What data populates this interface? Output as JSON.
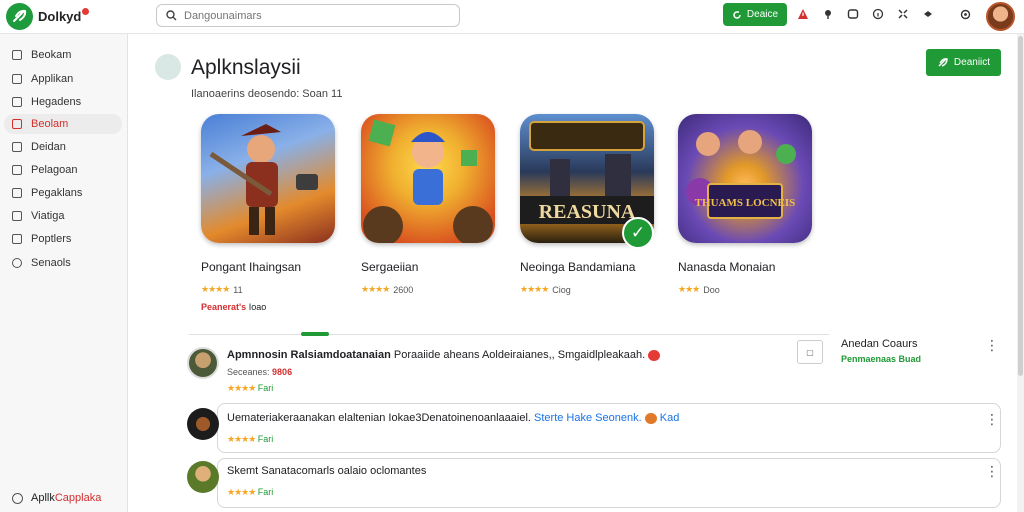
{
  "app": {
    "name": "Dolkyd",
    "logo_icon": "leaf-logo-icon"
  },
  "search": {
    "placeholder": "Dangounaimars",
    "value": ""
  },
  "topbar": {
    "action_label": "Deaice",
    "icons": [
      "alert-icon",
      "pin-icon",
      "square-icon",
      "info-icon",
      "grid-icon",
      "expand-icon",
      "settings-icon"
    ]
  },
  "sidebar": {
    "items": [
      {
        "label": "Beokam",
        "icon": "home-icon"
      },
      {
        "label": "Applikan",
        "icon": "apps-icon"
      },
      {
        "label": "Hegadens",
        "icon": "list-icon"
      },
      {
        "label": "Beolam",
        "icon": "star-icon",
        "active": true
      },
      {
        "label": "Deidan",
        "icon": "doc-icon"
      },
      {
        "label": "Pelagoan",
        "icon": "people-icon"
      },
      {
        "label": "Pegaklans",
        "icon": "chart-icon"
      },
      {
        "label": "Viatiga",
        "icon": "image-icon"
      },
      {
        "label": "Poptlers",
        "icon": "settings-icon"
      },
      {
        "label": "Senaols",
        "icon": "gear-icon"
      }
    ],
    "footer": {
      "prefix": "Apllk",
      "highlight": "Capplaka"
    }
  },
  "main": {
    "title": "Aplknslaysii",
    "subtitle": "Ilanoaerins deosendo: Soan 11",
    "action_label": "Deaniict"
  },
  "apps": [
    {
      "name": "Pongant Ihaingsan",
      "rating": "★★★★",
      "count": "11",
      "extra_red": "Peanerat's",
      "extra": "Ioao",
      "colors": [
        "#4a7fd6",
        "#e38a2c",
        "#8b2f1f"
      ]
    },
    {
      "name": "Sergaeiian",
      "rating": "★★★★",
      "count": "2600",
      "extra_red": "",
      "extra": "",
      "colors": [
        "#f0b030",
        "#d9501f",
        "#3a6fd8"
      ]
    },
    {
      "name": "Neoinga Bandamiana",
      "rating": "★★★★",
      "count": "Ciog",
      "extra_red": "",
      "extra": "",
      "overlay": "REASUNA",
      "colors": [
        "#2a3a5a",
        "#d68c25",
        "#5e8fcf"
      ]
    },
    {
      "name": "Nanasda Monaian",
      "rating": "★★★",
      "count": "Doo",
      "extra_red": "",
      "extra": "",
      "overlay": "THUAMS LOCNEIS",
      "colors": [
        "#6a4ab5",
        "#e39a27",
        "#3d2a7a"
      ]
    }
  ],
  "reviews": [
    {
      "author": "Apmnnosin Ralsiamdoatanaian",
      "text": "Poraaiide aheans Aoldeiraianes,, Smgaidlpleakaah.",
      "sub": "Seceanes:",
      "sub_red": "9806",
      "stars": "★★★★",
      "stars_green": "Fari"
    },
    {
      "author": "",
      "text": "Uemateriakeraanakan elaltenian Iokae3Denatoinenoanlaaaiel.",
      "link": "Sterte Hake Seonenk.",
      "link_tail": "Kad",
      "stars": "★★★★",
      "stars_green": "Fari"
    },
    {
      "author": "",
      "text": "Skemt Sanatacomarls oalaio oclomantes",
      "stars": "★★★★",
      "stars_green": "Fari"
    }
  ],
  "side_panel": {
    "title": "Anedan Coaurs",
    "subtitle": "Penmaenaas Buad"
  },
  "colors": {
    "accent": "#1f9a36",
    "red": "#d32f2f"
  }
}
